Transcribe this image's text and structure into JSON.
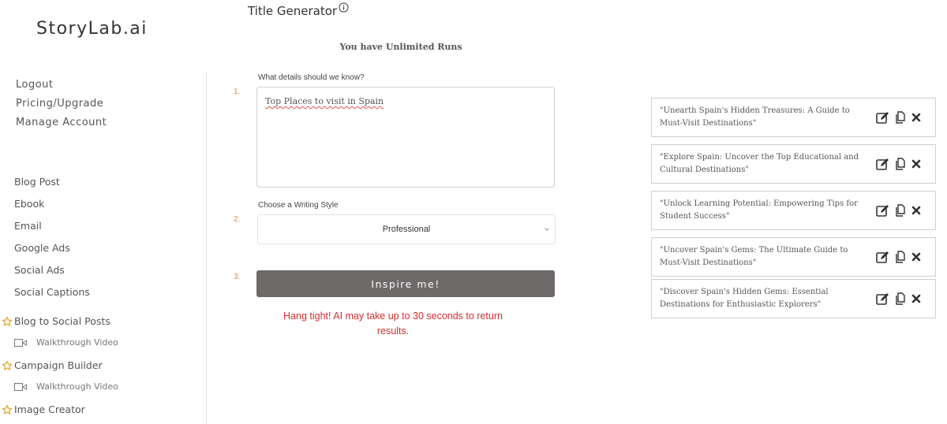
{
  "sidebar": {
    "logo": "StoryLab.ai",
    "account_links": [
      "Logout",
      "Pricing/Upgrade",
      "Manage Account"
    ],
    "tools": [
      "Blog Post",
      "Ebook",
      "Email",
      "Google Ads",
      "Social Ads",
      "Social Captions"
    ],
    "featured": [
      {
        "label": "Blog to Social Posts",
        "video": "Walkthrough Video"
      },
      {
        "label": "Campaign Builder",
        "video": "Walkthrough Video"
      },
      {
        "label": "Image Creator"
      }
    ],
    "star_color": "#e0a020"
  },
  "main": {
    "title": "Title Generator",
    "runs": "You have Unlimited Runs",
    "step1": {
      "number": "1.",
      "label": "What details should we know?",
      "value": "Top Places to visit in Spain"
    },
    "step2": {
      "number": "2.",
      "label": "Choose a Writing Style",
      "value": "Professional"
    },
    "step3": {
      "number": "3.",
      "button": "Inspire me!"
    },
    "warning": "Hang tight! AI may take up to 30 seconds to return results."
  },
  "results": [
    "\"Unearth Spain's Hidden Treasures: A Guide to Must-Visit Destinations\"",
    "\"Explore Spain: Uncover the Top Educational and Cultural Destinations\"",
    "\"Unlock Learning Potential: Empowering Tips for Student Success\"",
    "\"Uncover Spain's Gems: The Ultimate Guide to Must-Visit Destinations\"",
    "\"Discover Spain's Hidden Gems: Essential Destinations for Enthusiastic Explorers\""
  ],
  "colors": {
    "accent_step": "#e08a3c",
    "button": "#6e6a69",
    "warning": "#d32f2f"
  }
}
